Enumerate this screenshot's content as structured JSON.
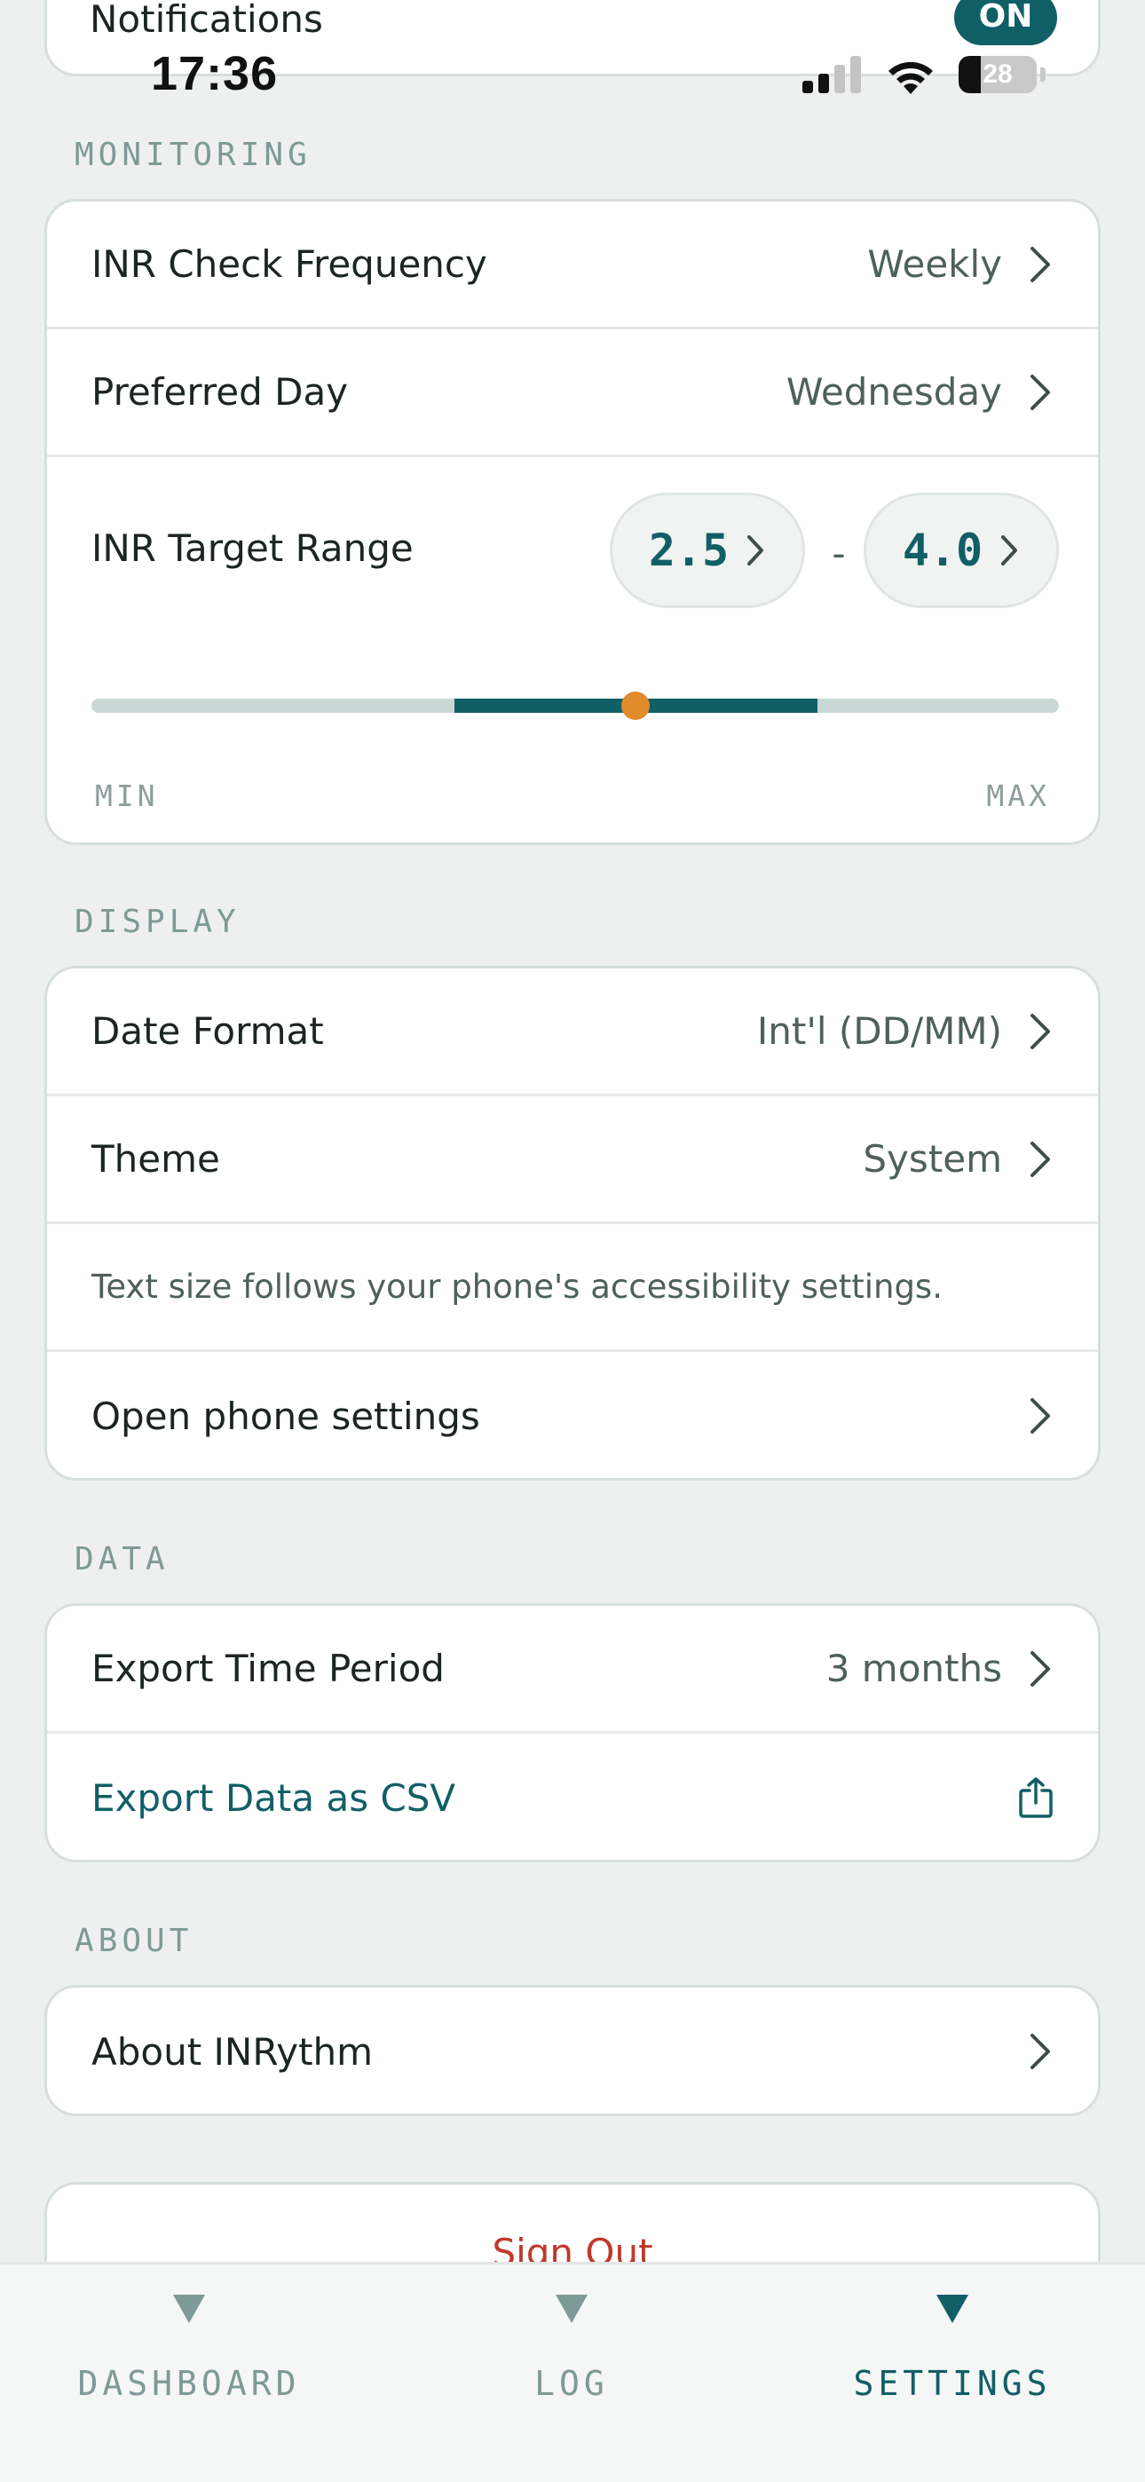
{
  "status_bar": {
    "time": "17:36",
    "battery": "28",
    "battery_percent": 28
  },
  "notifications": {
    "label": "Notifications",
    "toggle": "ON"
  },
  "monitoring": {
    "header": "MONITORING",
    "frequency_label": "INR Check Frequency",
    "frequency_value": "Weekly",
    "day_label": "Preferred Day",
    "day_value": "Wednesday",
    "target_label": "INR Target Range",
    "target_min": "2.5",
    "separator": "-",
    "target_max": "4.0",
    "slider": {
      "min_label": "MIN",
      "max_label": "MAX",
      "range_start_fraction": 0.375,
      "range_end_fraction": 0.75,
      "thumb_fraction": 0.5625
    }
  },
  "display": {
    "header": "DISPLAY",
    "date_format_label": "Date Format",
    "date_format_value": "Int'l (DD/MM)",
    "theme_label": "Theme",
    "theme_value": "System",
    "text_size_note": "Text size follows your phone's accessibility settings.",
    "phone_settings_label": "Open phone settings"
  },
  "data": {
    "header": "DATA",
    "export_period_label": "Export Time Period",
    "export_period_value": "3 months",
    "export_csv_label": "Export Data as CSV"
  },
  "about": {
    "header": "ABOUT",
    "about_label": "About INRythm"
  },
  "sign_out": {
    "label": "Sign Out"
  },
  "tabs": [
    {
      "label": "DASHBOARD"
    },
    {
      "label": "LOG"
    },
    {
      "label": "SETTINGS"
    }
  ],
  "colors": {
    "accent": "#115f66",
    "thumb": "#e08a2a",
    "danger": "#c0392b",
    "muted": "#7e9a96"
  }
}
